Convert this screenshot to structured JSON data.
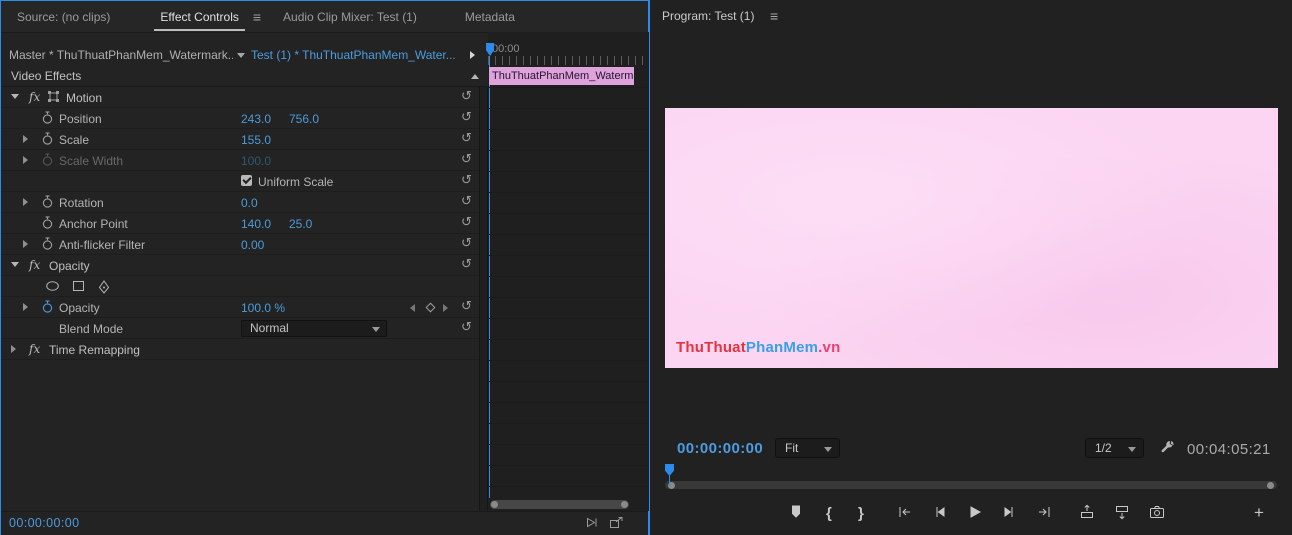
{
  "icons": {
    "panel_menu": "≡",
    "reset": "↺",
    "fx_badge": "fx"
  },
  "left_panel": {
    "tabs": [
      {
        "label": "Source: (no clips)"
      },
      {
        "label": "Effect Controls"
      },
      {
        "label": "Audio Clip Mixer: Test (1)"
      },
      {
        "label": "Metadata"
      }
    ],
    "master_clip": "Master * ThuThuatPhanMem_Watermark...",
    "sequence_clip": "Test (1) * ThuThuatPhanMem_Water...",
    "section_title": "Video Effects",
    "rows": [
      {
        "label": "Motion"
      },
      {
        "label": "Position",
        "v1": "243.0",
        "v2": "756.0"
      },
      {
        "label": "Scale",
        "v1": "155.0"
      },
      {
        "label": "Scale Width",
        "v1": "100.0"
      },
      {
        "label": "Uniform Scale"
      },
      {
        "label": "Rotation",
        "v1": "0.0"
      },
      {
        "label": "Anchor Point",
        "v1": "140.0",
        "v2": "25.0"
      },
      {
        "label": "Anti-flicker Filter",
        "v1": "0.00"
      },
      {
        "label": "Opacity"
      },
      {
        "label": ""
      },
      {
        "label": "Opacity",
        "v1": "100.0 %"
      },
      {
        "label": "Blend Mode",
        "value": "Normal"
      },
      {
        "label": "Time Remapping"
      }
    ],
    "timeline": {
      "ruler_start": "00:00",
      "clip_name": "ThuThuatPhanMem_Waterm"
    },
    "status_timecode": "00:00:00:00"
  },
  "program": {
    "title": "Program: Test (1)",
    "watermark": {
      "p1": "ThuThuat",
      "p2": "PhanMem",
      "p3": ".vn"
    },
    "timecode": "00:00:00:00",
    "zoom_level": "Fit",
    "playback_resolution": "1/2",
    "duration": "00:04:05:21",
    "transport": {
      "mark_in": "{",
      "mark_out": "}",
      "add_button": "+"
    }
  }
}
